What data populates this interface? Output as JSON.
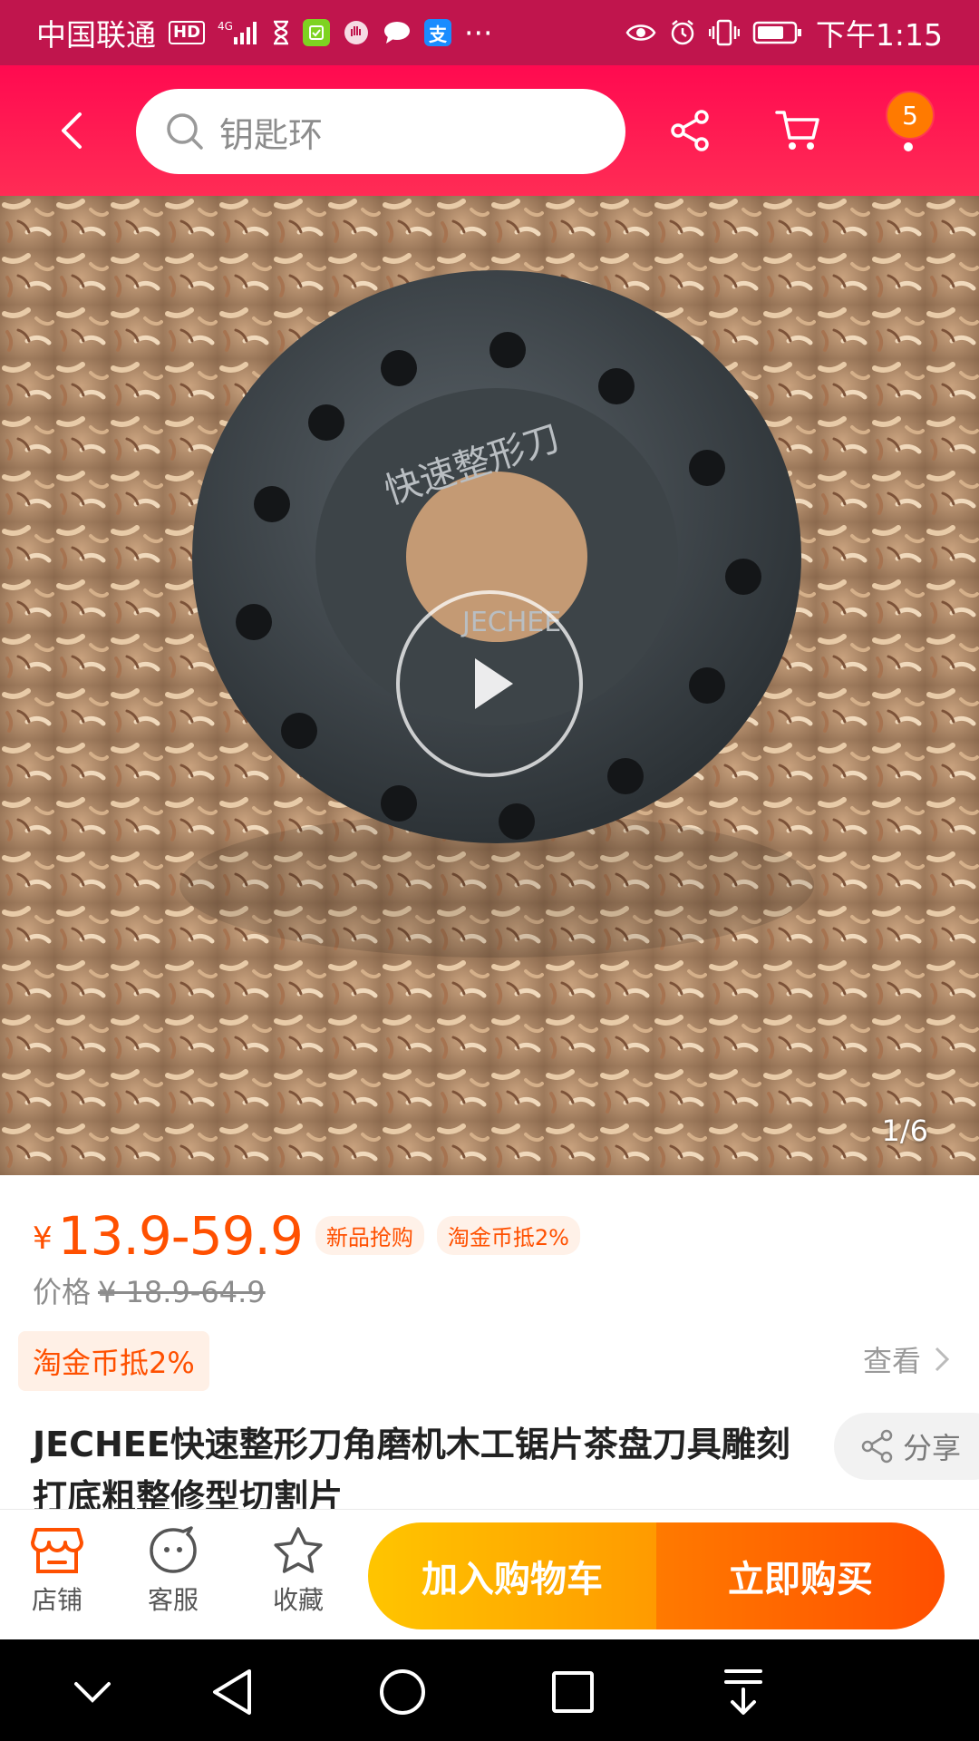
{
  "status_bar": {
    "carrier": "中国联通",
    "hd": "HD",
    "network": "4G",
    "app_alipay": "支",
    "more": "···",
    "time": "下午1:15"
  },
  "header": {
    "search_placeholder": "钥匙环",
    "cart_badge": "5",
    "icons": [
      "back-icon",
      "search-icon",
      "share-icon",
      "cart-icon",
      "more-icon"
    ]
  },
  "gallery": {
    "page_indicator": "1/6",
    "product_text": "快速整形刀",
    "brand": "JECHEE",
    "has_video": true
  },
  "price": {
    "currency": "¥",
    "range": "13.9-59.9",
    "tag_new": "新品抢购",
    "tag_coin": "淘金币抵2%",
    "original_label": "价格",
    "original_price": "¥ 18.9-64.9"
  },
  "coupon": {
    "chip": "淘金币抵2%",
    "view": "查看"
  },
  "title": {
    "text": "JECHEE快速整形刀角磨机木工锯片茶盘刀具雕刻打底粗整修型切割片",
    "share": "分享"
  },
  "action_bar": {
    "store": "店铺",
    "service": "客服",
    "favorite": "收藏",
    "add_to_cart": "加入购物车",
    "buy_now": "立即购买"
  },
  "colors": {
    "header": "#ff0a50",
    "status_bar": "#c0154d",
    "price": "#ff5000",
    "cart_button": "#ffb300",
    "buy_button": "#ff5a00"
  }
}
